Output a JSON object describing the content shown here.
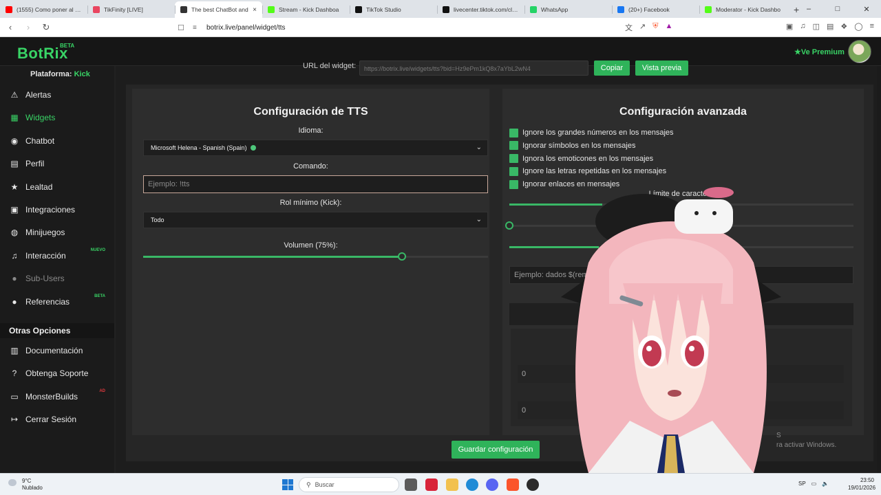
{
  "browser": {
    "tabs": [
      {
        "title": "(1555) Como poner al bot",
        "color": "#ff0000",
        "active": false
      },
      {
        "title": "TikFinity [LIVE]",
        "color": "#e94560",
        "active": false
      },
      {
        "title": "The best ChatBot and",
        "color": "#333333",
        "active": true
      },
      {
        "title": "Stream - Kick Dashboa",
        "color": "#53fc18",
        "active": false
      },
      {
        "title": "TikTok Studio",
        "color": "#111111",
        "active": false
      },
      {
        "title": "livecenter.tiktok.com/clips",
        "color": "#111111",
        "active": false
      },
      {
        "title": "WhatsApp",
        "color": "#25d366",
        "active": false
      },
      {
        "title": "(20+) Facebook",
        "color": "#1877f2",
        "active": false
      },
      {
        "title": "Moderator - Kick Dashbo",
        "color": "#53fc18",
        "active": false
      }
    ],
    "new_tab": "+",
    "url": "botrix.live/panel/widget/tts"
  },
  "app": {
    "logo": "BotRix",
    "logo_badge": "BETA",
    "premium": "Ve Premium",
    "platform_label": "Plataforma:",
    "platform_value": "Kick"
  },
  "sidebar": {
    "items": [
      {
        "label": "Alertas",
        "icon": "warning-icon"
      },
      {
        "label": "Widgets",
        "icon": "grid-icon",
        "active": true
      },
      {
        "label": "Chatbot",
        "icon": "robot-icon"
      },
      {
        "label": "Perfil",
        "icon": "id-card-icon"
      },
      {
        "label": "Lealtad",
        "icon": "trophy-icon"
      },
      {
        "label": "Integraciones",
        "icon": "plug-icon"
      },
      {
        "label": "Minijuegos",
        "icon": "gamepad-icon"
      },
      {
        "label": "Interacción",
        "icon": "music-icon",
        "badge": "NUEVO"
      },
      {
        "label": "Sub-Users",
        "icon": "users-icon",
        "disabled": true
      },
      {
        "label": "Referencias",
        "icon": "users-icon",
        "badge": "BETA"
      }
    ],
    "section_title": "Otras Opciones",
    "other_items": [
      {
        "label": "Documentación",
        "icon": "book-icon"
      },
      {
        "label": "Obtenga Soporte",
        "icon": "help-icon"
      },
      {
        "label": "MonsterBuilds",
        "icon": "laptop-icon",
        "badge": "AD"
      },
      {
        "label": "Cerrar Sesión",
        "icon": "logout-icon"
      }
    ]
  },
  "widget": {
    "url_label": "URL del widget:",
    "url_value": "https://botrix.live/widgets/tts?bid=Hz9ePm1kQ8x7aYbL2wN4",
    "copy_button": "Copiar",
    "preview_button": "Vista previa"
  },
  "tts": {
    "title": "Configuración de TTS",
    "language_label": "Idioma:",
    "language_value": "Microsoft Helena - Spanish (Spain)",
    "command_label": "Comando:",
    "command_placeholder": "Ejemplo: !tts",
    "role_label": "Rol mínimo (Kick):",
    "role_value": "Todo",
    "volume_label": "Volumen (75%):",
    "volume_value": 0.75
  },
  "advanced": {
    "title": "Configuración avanzada",
    "checks": [
      "Ignore los grandes números en los mensajes",
      "Ignorar símbolos en los mensajes",
      "Ignora los emoticones en los mensajes",
      "Ignore las letras repetidas en los mensajes",
      "Ignorar enlaces en mensajes"
    ],
    "char_limit_label": "Límite de caracteres",
    "slider1_value": 0.27,
    "slider2_value": 0.0,
    "slider3_value": 0.26,
    "example_placeholder": "Ejemplo: dados $(remite",
    "num1": "0",
    "num2": "0"
  },
  "save_button": "Guardar configuración",
  "watermark_line1": "S",
  "watermark_line2": "ra activar Windows.",
  "taskbar": {
    "temp": "9°C",
    "weather": "Nublado",
    "search_placeholder": "Buscar",
    "lang": "SP",
    "time": "23:50",
    "date": "19/01/2026"
  }
}
